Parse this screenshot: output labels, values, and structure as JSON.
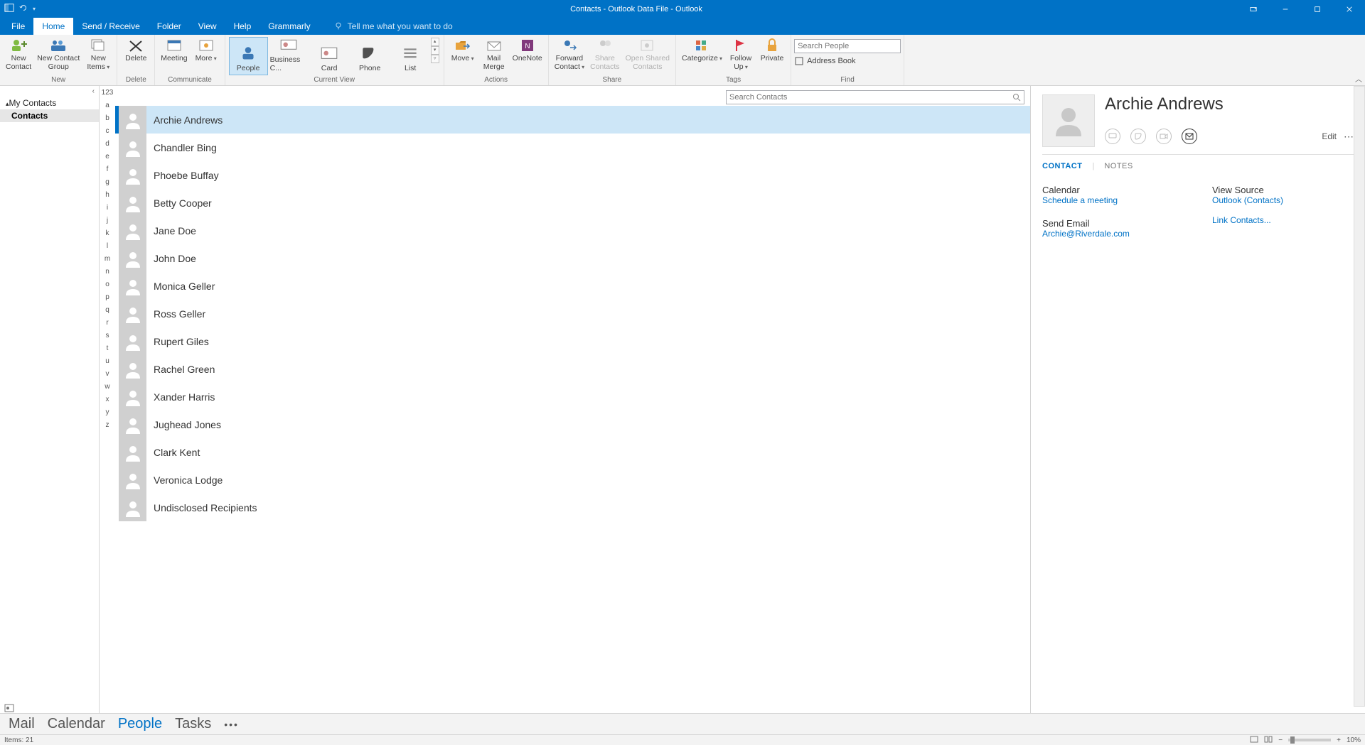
{
  "title": "Contacts - Outlook Data File  -  Outlook",
  "tabs": {
    "file": "File",
    "home": "Home",
    "sendreceive": "Send / Receive",
    "folder": "Folder",
    "view": "View",
    "help": "Help",
    "grammarly": "Grammarly",
    "tell_me": "Tell me what you want to do"
  },
  "ribbon": {
    "new": {
      "label": "New",
      "new_contact": "New\nContact",
      "new_group": "New Contact\nGroup",
      "new_items": "New\nItems"
    },
    "delete": {
      "label": "Delete",
      "delete_btn": "Delete"
    },
    "communicate": {
      "label": "Communicate",
      "meeting": "Meeting",
      "more": "More"
    },
    "current_view": {
      "label": "Current View",
      "people": "People",
      "business": "Business C...",
      "card": "Card",
      "phone": "Phone",
      "list": "List"
    },
    "actions": {
      "label": "Actions",
      "move": "Move",
      "mail_merge": "Mail\nMerge",
      "onenote": "OneNote"
    },
    "share": {
      "label": "Share",
      "forward": "Forward\nContact",
      "share_contacts": "Share\nContacts",
      "open_shared": "Open Shared\nContacts"
    },
    "tags": {
      "label": "Tags",
      "categorize": "Categorize",
      "follow_up": "Follow\nUp",
      "private": "Private"
    },
    "find": {
      "label": "Find",
      "search_placeholder": "Search People",
      "address_book": "Address Book"
    }
  },
  "leftnav": {
    "my_contacts": "My Contacts",
    "contacts": "Contacts"
  },
  "alpha": [
    "123",
    "a",
    "b",
    "c",
    "d",
    "e",
    "f",
    "g",
    "h",
    "i",
    "j",
    "k",
    "l",
    "m",
    "n",
    "o",
    "p",
    "q",
    "r",
    "s",
    "t",
    "u",
    "v",
    "w",
    "x",
    "y",
    "z"
  ],
  "search_contacts_placeholder": "Search Contacts",
  "contacts": [
    "Archie Andrews",
    "Chandler Bing",
    "Phoebe Buffay",
    "Betty Cooper",
    "Jane Doe",
    "John Doe",
    "Monica Geller",
    "Ross Geller",
    "Rupert Giles",
    "Rachel Green",
    "Xander Harris",
    "Jughead Jones",
    "Clark Kent",
    "Veronica Lodge",
    "Undisclosed Recipients"
  ],
  "reading": {
    "name": "Archie Andrews",
    "edit": "Edit",
    "tab_contact": "CONTACT",
    "tab_notes": "NOTES",
    "calendar": "Calendar",
    "schedule": "Schedule a meeting",
    "send_email": "Send Email",
    "email": "Archie@Riverdale.com",
    "view_source": "View Source",
    "outlook_contacts": "Outlook (Contacts)",
    "link_contacts": "Link Contacts..."
  },
  "bottomnav": {
    "mail": "Mail",
    "calendar": "Calendar",
    "people": "People",
    "tasks": "Tasks"
  },
  "status": {
    "items": "Items: 21",
    "zoom": "10%"
  }
}
